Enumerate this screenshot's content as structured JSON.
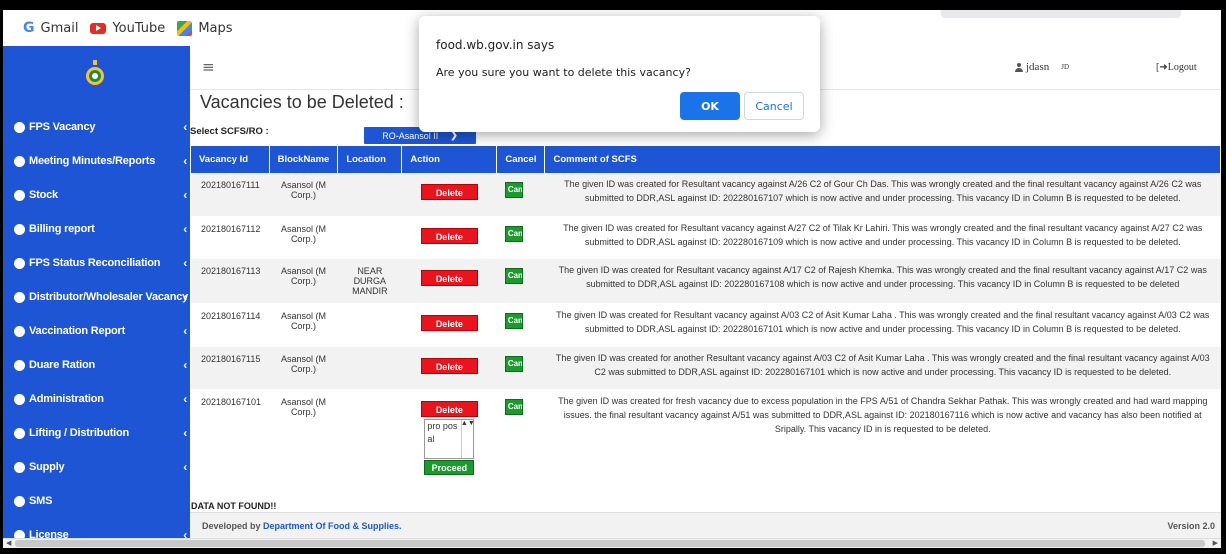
{
  "bookmarks": [
    {
      "label": "Gmail",
      "icon": "gmail-icon"
    },
    {
      "label": "YouTube",
      "icon": "youtube-icon"
    },
    {
      "label": "Maps",
      "icon": "maps-icon"
    }
  ],
  "sidebar": {
    "items": [
      {
        "label": "FPS Vacancy"
      },
      {
        "label": "Meeting Minutes/Reports"
      },
      {
        "label": "Stock"
      },
      {
        "label": "Billing report"
      },
      {
        "label": "FPS Status Reconciliation"
      },
      {
        "label": "Distributor/Wholesaler Vacancy"
      },
      {
        "label": "Vaccination Report"
      },
      {
        "label": "Duare Ration"
      },
      {
        "label": "Administration"
      },
      {
        "label": "Lifting / Distribution"
      },
      {
        "label": "Supply"
      },
      {
        "label": "SMS"
      },
      {
        "label": "License"
      }
    ]
  },
  "topbar": {
    "menu_icon": "≡",
    "username": "jdasn",
    "user_sup": "JD",
    "logout": "[➜Logout"
  },
  "page": {
    "title": "Vacancies to be Deleted :",
    "select_label": "Select SCFS/RO :",
    "select_value": "RO-Asansol II"
  },
  "table": {
    "headers": [
      "Vacancy Id",
      "BlockName",
      "Location",
      "Action",
      "Cancel",
      "Comment of SCFS"
    ],
    "delete_label": "Delete",
    "cancel_label": "Cancel",
    "rows": [
      {
        "id": "202180167111",
        "block": "Asansol (M Corp.)",
        "location": "",
        "comment": "The given ID was created for Resultant vacancy against A/26 C2 of Gour Ch Das. This was wrongly created and the final resultant vacancy against A/26 C2 was submitted to DDR,ASL against ID: 202280167107 which is now active and under processing. This vacancy ID in Column B is requested to be deleted."
      },
      {
        "id": "202180167112",
        "block": "Asansol (M Corp.)",
        "location": "",
        "comment": "The given ID was created for Resultant vacancy against A/27 C2 of Tilak Kr Lahiri. This was wrongly created and the final resultant vacancy against A/27 C2 was submitted to DDR,ASL against ID: 202280167109 which is now active and under processing. This vacancy ID in Column B is requested to be deleted."
      },
      {
        "id": "202180167113",
        "block": "Asansol (M Corp.)",
        "location": "NEAR DURGA MANDIR",
        "comment": "The given ID was created for Resultant vacancy against A/17 C2 of Rajesh Khemka. This was wrongly created and the final resultant vacancy against A/17 C2 was submitted to DDR,ASL against ID: 202280167108 which is now active and under processing. This vacancy ID in Column B is requested to be deleted"
      },
      {
        "id": "202180167114",
        "block": "Asansol (M Corp.)",
        "location": "",
        "comment": "The given ID was created for Resultant vacancy against A/03 C2 of Asit Kumar Laha . This was wrongly created and the final resultant vacancy against A/03 C2 was submitted to DDR,ASL against ID: 202280167101 which is now active and under processing. This vacancy ID in Column B is requested to be deleted."
      },
      {
        "id": "202180167115",
        "block": "Asansol (M Corp.)",
        "location": "",
        "comment": "The given ID was created for another Resultant vacancy against A/03 C2 of Asit Kumar Laha . This was wrongly created and the final resultant vacancy against A/03 C2 was submitted to DDR,ASL against ID: 202280167101 which is now active and under processing. This vacancy ID is requested to be deleted."
      },
      {
        "id": "202180167101",
        "block": "Asansol (M Corp.)",
        "location": "",
        "comment": "The given ID was created for fresh vacancy due to excess population in the FPS A/51 of Chandra Sekhar Pathak. This was wrongly created and had ward mapping issues. the final resultant vacancy against A/51 was submitted to DDR,ASL against ID: 202180167116 which is now active and vacancy has also been notified at Sripally. This vacancy ID in is requested to be deleted."
      }
    ],
    "proposal_text": "pro pos al",
    "proceed_label": "Proceed"
  },
  "status": {
    "not_found": "DATA NOT FOUND!!"
  },
  "footer": {
    "prefix": "Developed by",
    "link": "Department Of Food & Supplies.",
    "version": "Version 2.0"
  },
  "dialog": {
    "origin": "food.wb.gov.in says",
    "message": "Are you sure you want to delete this vacancy?",
    "ok": "OK",
    "cancel": "Cancel"
  },
  "colors": {
    "brand_blue": "#1d55d4",
    "delete_red": "#e8141e",
    "proceed_green": "#1a9b2c",
    "dialog_blue": "#1a73e8"
  }
}
